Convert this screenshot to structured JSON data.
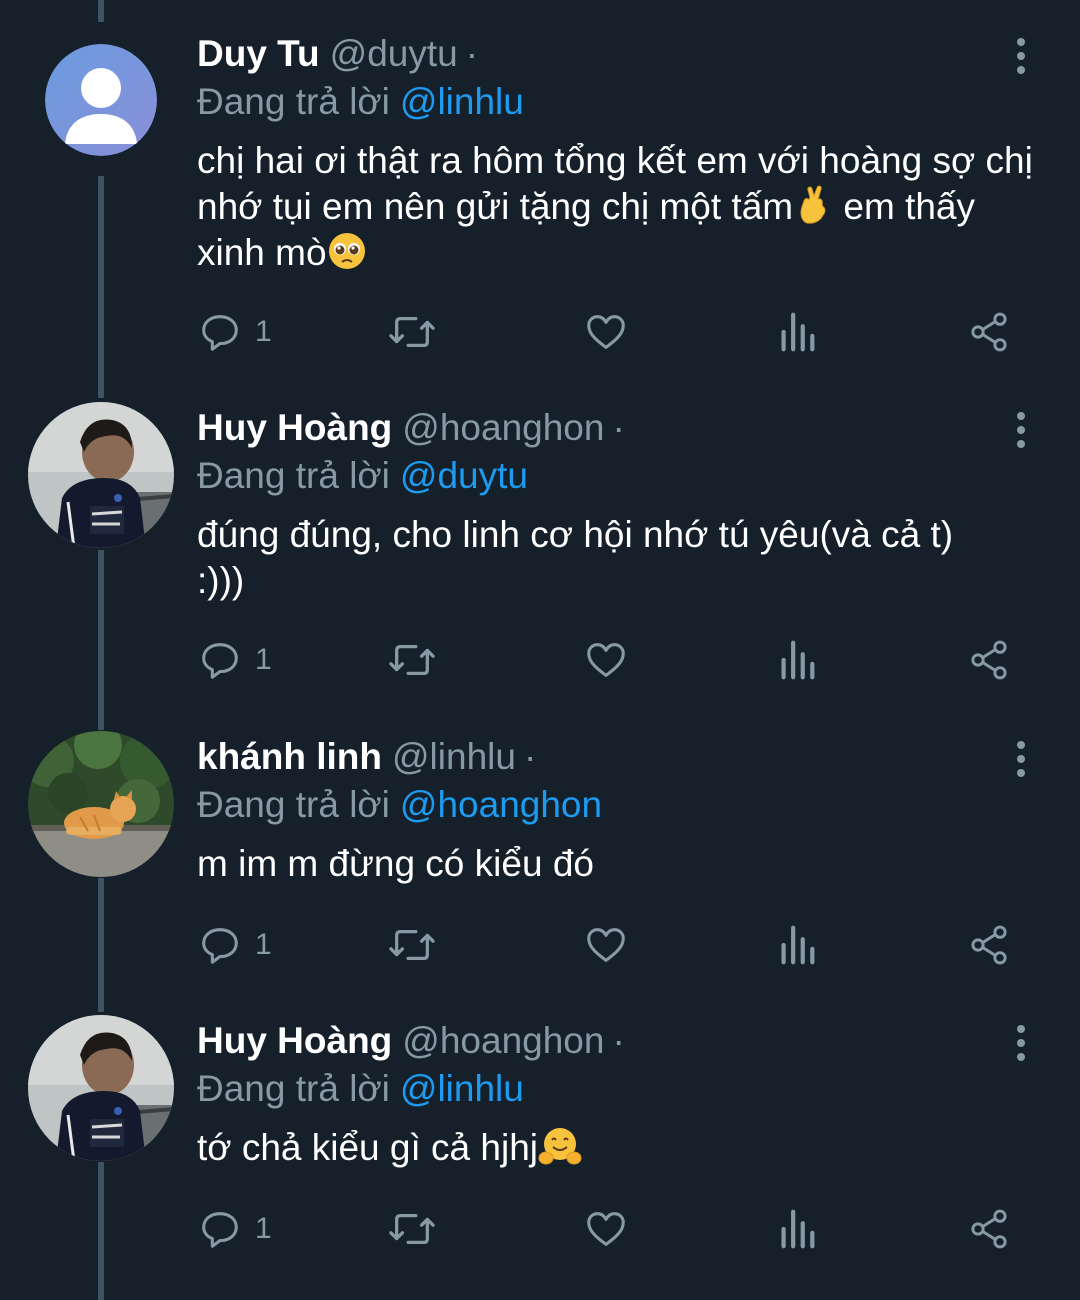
{
  "reply_prefix": "Đang trả lời",
  "dot": "·",
  "colors": {
    "background": "#15202b",
    "text": "#ffffff",
    "secondary": "#8899a6",
    "accent": "#1d9bf0",
    "thread_line": "#3d5466"
  },
  "tweets": [
    {
      "display_name": "Duy Tu",
      "handle": "@duytu",
      "reply_to": "@linhlu",
      "text_before": "chị hai ơi thật ra hôm tổng kết em với hoàng sợ chị nhớ tụi em nên gửi tặng chị một tấm",
      "emoji_1": "crossed-fingers-emoji",
      "text_mid": " em thấy xinh mò",
      "emoji_2": "pleading-face-emoji",
      "reply_count": "1",
      "avatar": "default-avatar"
    },
    {
      "display_name": "Huy Hoàng",
      "handle": "@hoanghon",
      "reply_to": "@duytu",
      "text": "đúng đúng, cho linh cơ hội nhớ tú yêu(và cả t) :)))",
      "reply_count": "1",
      "avatar": "person-photo"
    },
    {
      "display_name": "khánh linh",
      "handle": "@linhlu",
      "reply_to": "@hoanghon",
      "text": "m im m đừng có kiểu đó",
      "reply_count": "1",
      "avatar": "cat-photo"
    },
    {
      "display_name": "Huy Hoàng",
      "handle": "@hoanghon",
      "reply_to": "@linhlu",
      "text": "tớ chả kiểu gì cả hjhj",
      "emoji": "hugging-face-emoji",
      "reply_count": "1",
      "avatar": "person-photo"
    }
  ],
  "action_icons": [
    "reply-icon",
    "retweet-icon",
    "like-icon",
    "analytics-icon",
    "share-icon"
  ]
}
